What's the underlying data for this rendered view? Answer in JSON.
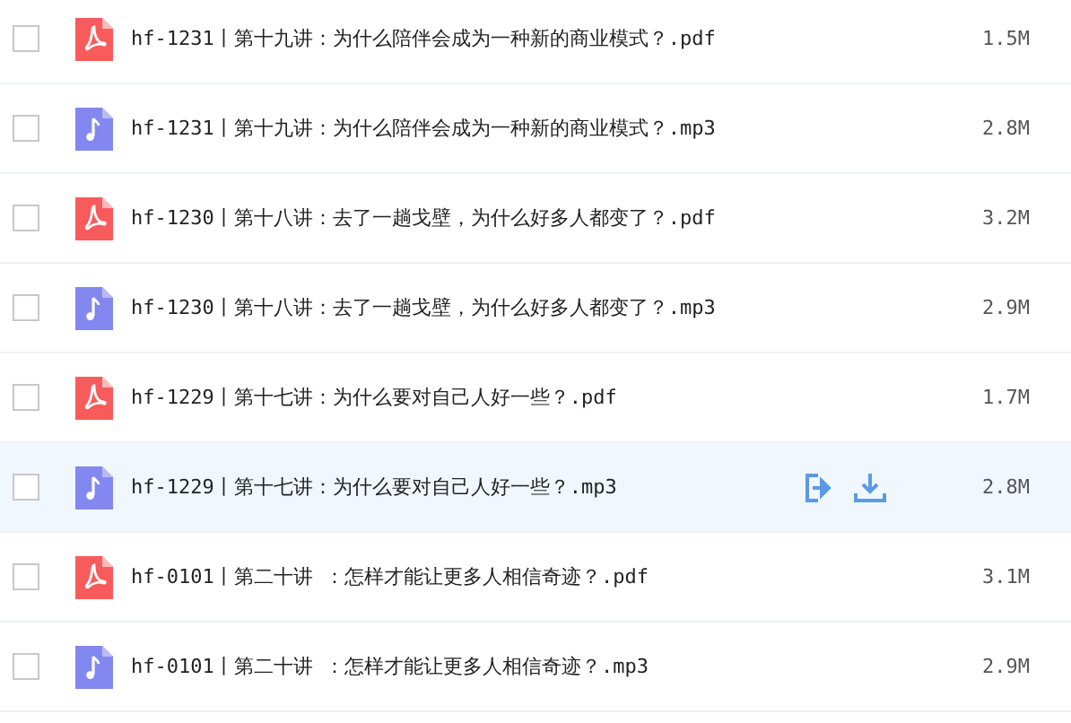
{
  "files": [
    {
      "kind": "pdf",
      "name": "hf-1231丨第十九讲：为什么陪伴会成为一种新的商业模式？.pdf",
      "size": "1.5M",
      "checked": false,
      "hovered": false
    },
    {
      "kind": "audio",
      "name": "hf-1231丨第十九讲：为什么陪伴会成为一种新的商业模式？.mp3",
      "size": "2.8M",
      "checked": false,
      "hovered": false
    },
    {
      "kind": "pdf",
      "name": "hf-1230丨第十八讲：去了一趟戈壁，为什么好多人都变了？.pdf",
      "size": "3.2M",
      "checked": false,
      "hovered": false
    },
    {
      "kind": "audio",
      "name": "hf-1230丨第十八讲：去了一趟戈壁，为什么好多人都变了？.mp3",
      "size": "2.9M",
      "checked": false,
      "hovered": false
    },
    {
      "kind": "pdf",
      "name": "hf-1229丨第十七讲：为什么要对自己人好一些？.pdf",
      "size": "1.7M",
      "checked": false,
      "hovered": false
    },
    {
      "kind": "audio",
      "name": "hf-1229丨第十七讲：为什么要对自己人好一些？.mp3",
      "size": "2.8M",
      "checked": false,
      "hovered": true
    },
    {
      "kind": "pdf",
      "name": "hf-0101丨第二十讲 ：怎样才能让更多人相信奇迹？.pdf",
      "size": "3.1M",
      "checked": false,
      "hovered": false
    },
    {
      "kind": "audio",
      "name": "hf-0101丨第二十讲 ：怎样才能让更多人相信奇迹？.mp3",
      "size": "2.9M",
      "checked": false,
      "hovered": false
    }
  ]
}
